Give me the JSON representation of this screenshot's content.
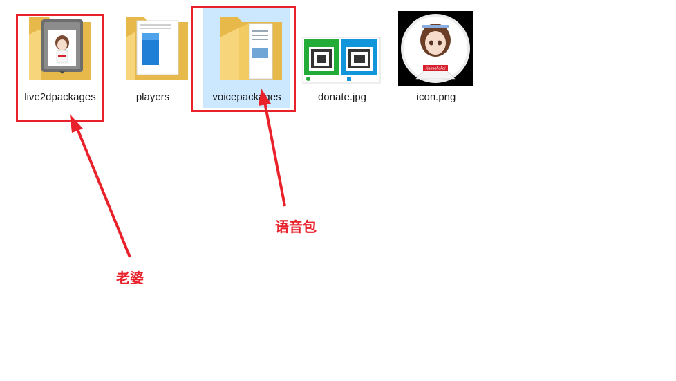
{
  "files": [
    {
      "name": "live2dpackages",
      "type": "folder"
    },
    {
      "name": "players",
      "type": "folder"
    },
    {
      "name": "voicepackages",
      "type": "folder"
    },
    {
      "name": "donate.jpg",
      "type": "image"
    },
    {
      "name": "icon.png",
      "type": "image"
    }
  ],
  "selected_file": "voicepackages",
  "annotations": {
    "live2d_label": "老婆",
    "voice_label": "语音包",
    "color": "#e8212a"
  },
  "avatar_caption": "Kaimahakai",
  "colors": {
    "folder_yellow": "#f7d57a",
    "folder_dark": "#e7b84a",
    "selection": "#cce8ff",
    "wechat_green": "#23ac38",
    "alipay_blue": "#1296db"
  }
}
